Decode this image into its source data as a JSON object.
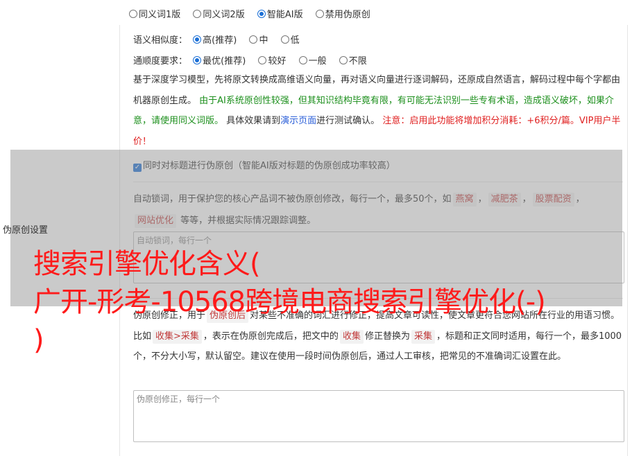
{
  "version_options": [
    {
      "label": "同义词1版",
      "selected": false
    },
    {
      "label": "同义词2版",
      "selected": false
    },
    {
      "label": "智能AI版",
      "selected": true
    },
    {
      "label": "禁用伪原创",
      "selected": false
    }
  ],
  "similarity": {
    "label": "语义相似度：",
    "options": [
      {
        "label": "高(推荐)",
        "selected": true
      },
      {
        "label": "中",
        "selected": false
      },
      {
        "label": "低",
        "selected": false
      }
    ]
  },
  "fluency": {
    "label": "通顺度要求：",
    "options": [
      {
        "label": "最优(推荐)",
        "selected": true
      },
      {
        "label": "较好",
        "selected": false
      },
      {
        "label": "一般",
        "selected": false
      },
      {
        "label": "不限",
        "selected": false
      }
    ]
  },
  "description": {
    "part1": "基于深度学习模型，先将原文转换成高维语义向量，再对语义向量进行逐词解码，还原成自然语言，解码过程中每个字都由机器原创生成。 ",
    "part2_green": "由于AI系统原创性较强，但其知识结构毕竟有限，有可能无法识别一些专有术语，造成语义破坏，如果介意，请使用同义词版。",
    "part3": " 具体效果请到",
    "demo_link": "演示页面",
    "part4": "进行测试确认。 ",
    "part5_red": "注意：启用此功能将增加积分消耗：+6积分/篇。VIP用户半价！"
  },
  "title_checkbox": {
    "label": "同时对标题进行伪原创（智能AI版对标题的伪原创成功率较高）",
    "checked": true
  },
  "section_label": "伪原创设置",
  "lock_words": {
    "text1": "自动锁词，用于保护您的核心产品词不被伪原创修改，每行一个，最多50个，如",
    "examples": [
      "燕窝",
      "减肥茶",
      "股票配资",
      "网站优化"
    ],
    "sep": "，",
    "text2": "等等，并根据实际情况跟踪调整。",
    "placeholder": "自动锁词，每行一个"
  },
  "correction": {
    "text1": "伪原创修正，用于",
    "chip1": "伪原创后",
    "text2": "对某些不准确的词汇进行修正，提高文章可读性，使文章更符合您网站所在行业的用语习惯。比如",
    "chip2": "收集>采集",
    "text3": "，表示在伪原创完成后，把文中的",
    "chip3": "收集",
    "text4": "修正替换为",
    "chip4": "采集",
    "text5": "，标题和正文同时适用，每行一个，最多1000个，不分大小写，默认留空。建议在使用一段时间伪原创后，通过人工审核，把常见的不准确词汇设置在此。",
    "placeholder": "伪原创修正，每行一个"
  },
  "watermark": {
    "line1": "搜索引擎优化含义(",
    "line2": "广开-形考-10568跨境电商搜索引擎优化(-)",
    "line3": ")"
  },
  "colors": {
    "accent": "#1a6fd6",
    "green_text": "#1c8f1c",
    "red_text": "#e02020",
    "watermark": "#ff1a1a"
  }
}
